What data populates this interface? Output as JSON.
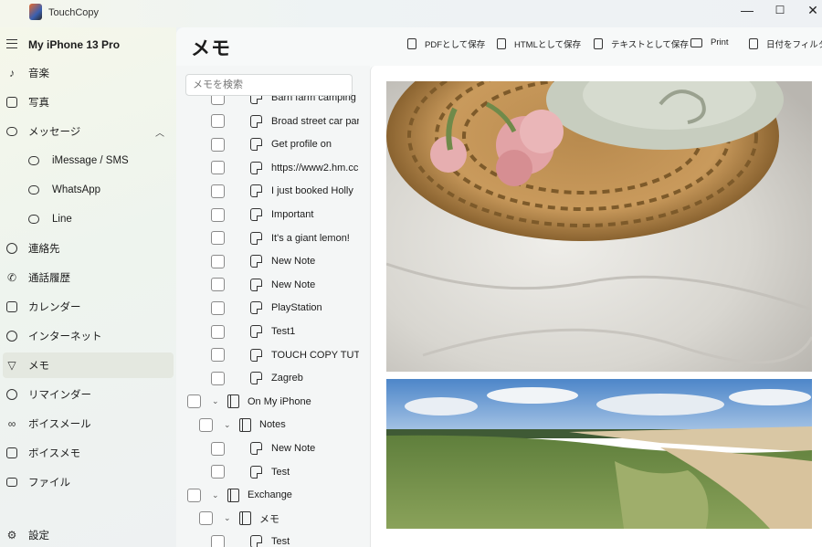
{
  "app": {
    "title": "TouchCopy"
  },
  "window_controls": {
    "minimize": "—",
    "maximize": "☐",
    "close": "✕"
  },
  "sidebar": {
    "device": "My iPhone 13 Pro",
    "items": [
      {
        "label": "音楽",
        "icon": "music-note-icon"
      },
      {
        "label": "写真",
        "icon": "photo-icon"
      },
      {
        "label": "メッセージ",
        "icon": "message-bubble-icon",
        "expanded": true
      },
      {
        "label": "iMessage / SMS",
        "icon": "chat-bubble-icon"
      },
      {
        "label": "WhatsApp",
        "icon": "chat-bubble-icon"
      },
      {
        "label": "Line",
        "icon": "chat-bubble-icon"
      },
      {
        "label": "連絡先",
        "icon": "person-icon"
      },
      {
        "label": "通話履歴",
        "icon": "phone-icon"
      },
      {
        "label": "カレンダー",
        "icon": "calendar-icon"
      },
      {
        "label": "インターネット",
        "icon": "globe-icon"
      },
      {
        "label": "メモ",
        "icon": "notes-icon",
        "active": true
      },
      {
        "label": "リマインダー",
        "icon": "bulb-icon"
      },
      {
        "label": "ボイスメール",
        "icon": "voicemail-icon"
      },
      {
        "label": "ボイスメモ",
        "icon": "voice-memo-icon"
      },
      {
        "label": "ファイル",
        "icon": "folder-icon"
      }
    ],
    "settings": "設定"
  },
  "main": {
    "title": "メモ",
    "toolbar": {
      "pdf": "PDFとして保存",
      "html": "HTMLとして保存",
      "text": "テキストとして保存",
      "print": "Print",
      "filter": "日付をフィルター"
    },
    "search_placeholder": "メモを検索"
  },
  "notes_tree": [
    {
      "type": "note",
      "label": "Barn farm camping"
    },
    {
      "type": "note",
      "label": "Broad street car par"
    },
    {
      "type": "note",
      "label": "Get profile on"
    },
    {
      "type": "note",
      "label": "https://www2.hm.cc"
    },
    {
      "type": "note",
      "label": "I just booked Holly"
    },
    {
      "type": "note",
      "label": "Important"
    },
    {
      "type": "note",
      "label": "It's a giant lemon!"
    },
    {
      "type": "note",
      "label": "New Note"
    },
    {
      "type": "note",
      "label": "New Note"
    },
    {
      "type": "note",
      "label": "PlayStation"
    },
    {
      "type": "note",
      "label": "Test1"
    },
    {
      "type": "note",
      "label": "TOUCH COPY TUTC"
    },
    {
      "type": "note",
      "label": "Zagreb"
    },
    {
      "type": "account",
      "label": "On My iPhone"
    },
    {
      "type": "folder",
      "label": "Notes"
    },
    {
      "type": "note",
      "label": "New Note"
    },
    {
      "type": "note",
      "label": "Test"
    },
    {
      "type": "account",
      "label": "Exchange"
    },
    {
      "type": "folder",
      "label": "メモ"
    },
    {
      "type": "note",
      "label": "Test"
    }
  ],
  "colors": {
    "accent_sidebar_active": "#e4e8e0",
    "background": "#f7f9f9"
  }
}
